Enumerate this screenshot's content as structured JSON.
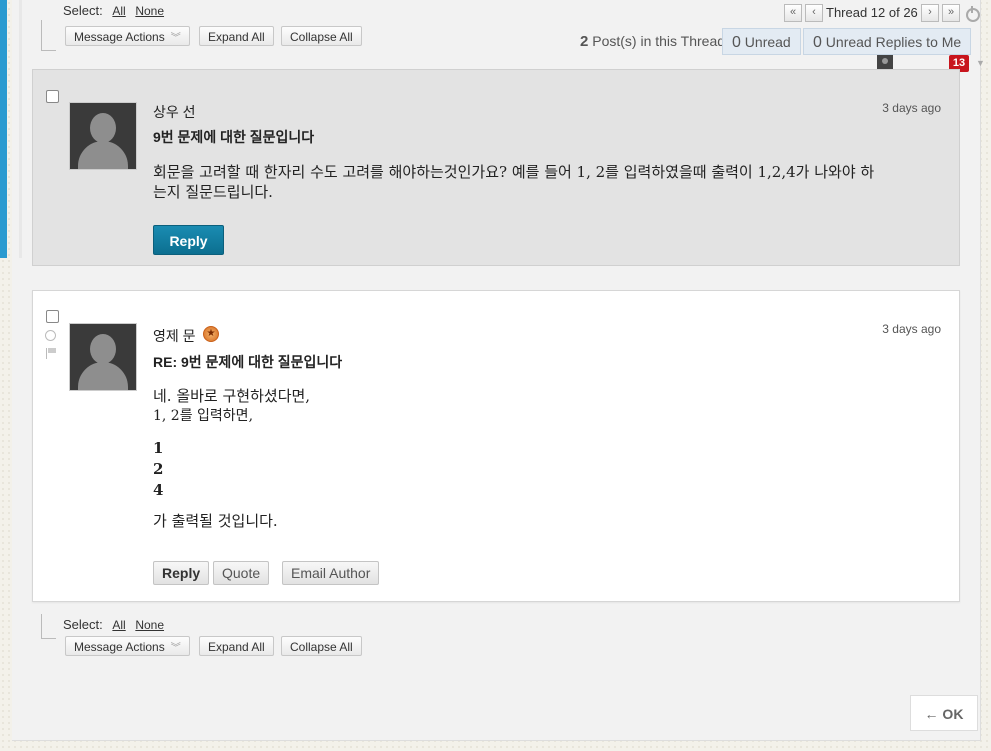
{
  "toolbar": {
    "select_label": "Select:",
    "all": "All",
    "none": "None",
    "message_actions": "Message Actions",
    "expand_all": "Expand All",
    "collapse_all": "Collapse All"
  },
  "pager": {
    "first": "«",
    "prev": "‹",
    "text": "Thread 12 of 26",
    "next": "›",
    "last": "»"
  },
  "thread_info": {
    "posts_count": "2",
    "posts_label": "Post(s) in this Thread",
    "unread_count": "0",
    "unread_label": "Unread",
    "unread_replies_count": "0",
    "unread_replies_label": "Unread Replies to Me"
  },
  "notification_badge": "13",
  "posts": [
    {
      "author": "상우 선",
      "subject": "9번 문제에 대한 질문입니다",
      "time": "3 days ago",
      "body_lines": [
        "회문을 고려할 때 한자리 수도 고려를 해야하는것인가요? 예를 들어 1, 2를 입력하였을때 출력이 1,2,4가 나와야 하",
        "는지 질문드립니다."
      ],
      "reply": "Reply"
    },
    {
      "author": "영제 문",
      "subject": "RE: 9번 문제에 대한 질문입니다",
      "time": "3 days ago",
      "body_lines": [
        "네. 올바로 구현하셨다면,",
        "1, 2를 입력하면,",
        "1",
        "2",
        "4",
        "가 출력될 것입니다."
      ],
      "reply": "Reply",
      "quote": "Quote",
      "email_author": "Email Author"
    }
  ],
  "ok_button": "← OK",
  "colors": {
    "accent": "#2a9ad0",
    "reply_button": "#0c6f90",
    "badge": "#c8151d",
    "unread_pill": "#e3ebf3"
  }
}
